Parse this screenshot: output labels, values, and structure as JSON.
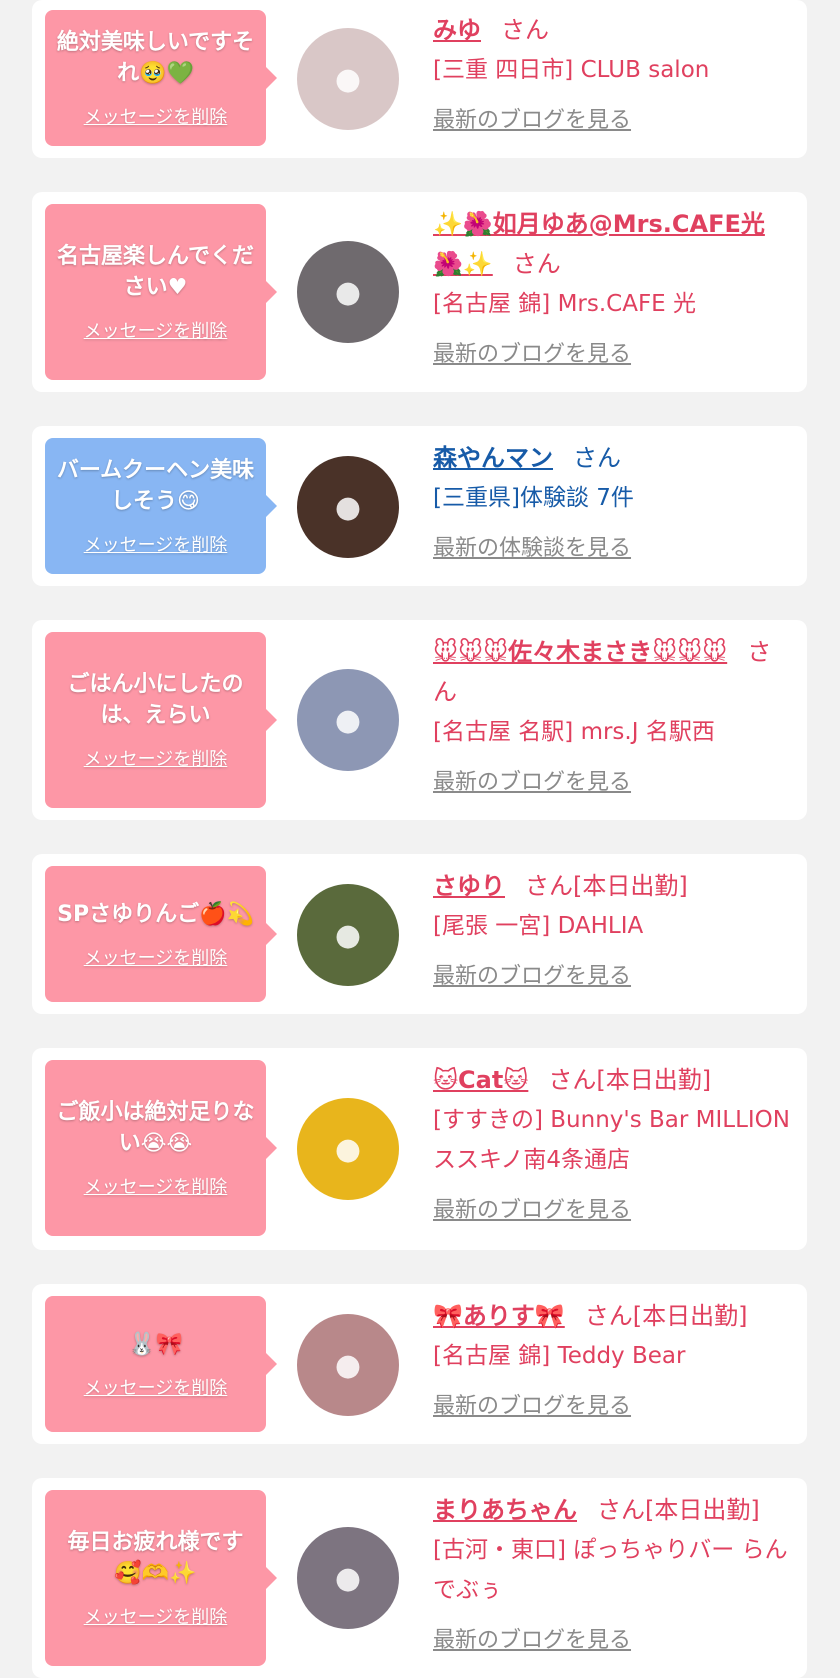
{
  "entries": [
    {
      "message": "絶対美味しいですそれ🥹💚",
      "delete_label": "メッセージを削除",
      "name": "みゆ",
      "honorific": "さん",
      "shop": "[三重 四日市] CLUB salon",
      "link": "最新のブログを見る",
      "bubble_color": "pink",
      "avatar_color": "#d9c7c7"
    },
    {
      "message": "名古屋楽しんでください♥",
      "delete_label": "メッセージを削除",
      "name": "✨🌺如月ゆあ@Mrs.CAFE光🌺✨",
      "honorific": "さん",
      "shop": "[名古屋 錦] Mrs.CAFE 光",
      "link": "最新のブログを見る",
      "bubble_color": "pink",
      "avatar_color": "#6f6a6e"
    },
    {
      "message": "バームクーヘン美味しそう😋",
      "delete_label": "メッセージを削除",
      "name": "森やんマン",
      "honorific": "さん",
      "shop": "[三重県]体験談 7件",
      "link": "最新の体験談を見る",
      "bubble_color": "blue",
      "avatar_color": "#4a3228"
    },
    {
      "message": "ごはん小にしたのは、えらい",
      "delete_label": "メッセージを削除",
      "name": "🐭🐭🐭佐々木まさき🐭🐭🐭",
      "honorific": "さん",
      "shop": "[名古屋 名駅] mrs.J 名駅西",
      "link": "最新のブログを見る",
      "bubble_color": "pink",
      "avatar_color": "#8d97b4"
    },
    {
      "message": "SPさゆりんご🍎💫",
      "delete_label": "メッセージを削除",
      "name": "さゆり",
      "honorific": "さん[本日出勤]",
      "shop": "[尾張 一宮] DAHLIA",
      "link": "最新のブログを見る",
      "bubble_color": "pink",
      "avatar_color": "#5a6a3c"
    },
    {
      "message": "ご飯小は絶対足りない😭😭",
      "delete_label": "メッセージを削除",
      "name": "🐱Cat🐱",
      "honorific": "さん[本日出勤]",
      "shop": "[すすきの] Bunny's Bar MILLION ススキノ南4条通店",
      "link": "最新のブログを見る",
      "bubble_color": "pink",
      "avatar_color": "#e8b51c"
    },
    {
      "message": "🐰🎀",
      "delete_label": "メッセージを削除",
      "name": "🎀ありす🎀",
      "honorific": "さん[本日出勤]",
      "shop": "[名古屋 錦] Teddy Bear",
      "link": "最新のブログを見る",
      "bubble_color": "pink",
      "avatar_color": "#b8888a"
    },
    {
      "message": "毎日お疲れ様です🥰🫶✨",
      "delete_label": "メッセージを削除",
      "name": "まりあちゃん",
      "honorific": "さん[本日出勤]",
      "shop": "[古河・東口] ぽっちゃりバー らんでぶぅ",
      "link": "最新のブログを見る",
      "bubble_color": "pink",
      "avatar_color": "#7d7480"
    }
  ]
}
